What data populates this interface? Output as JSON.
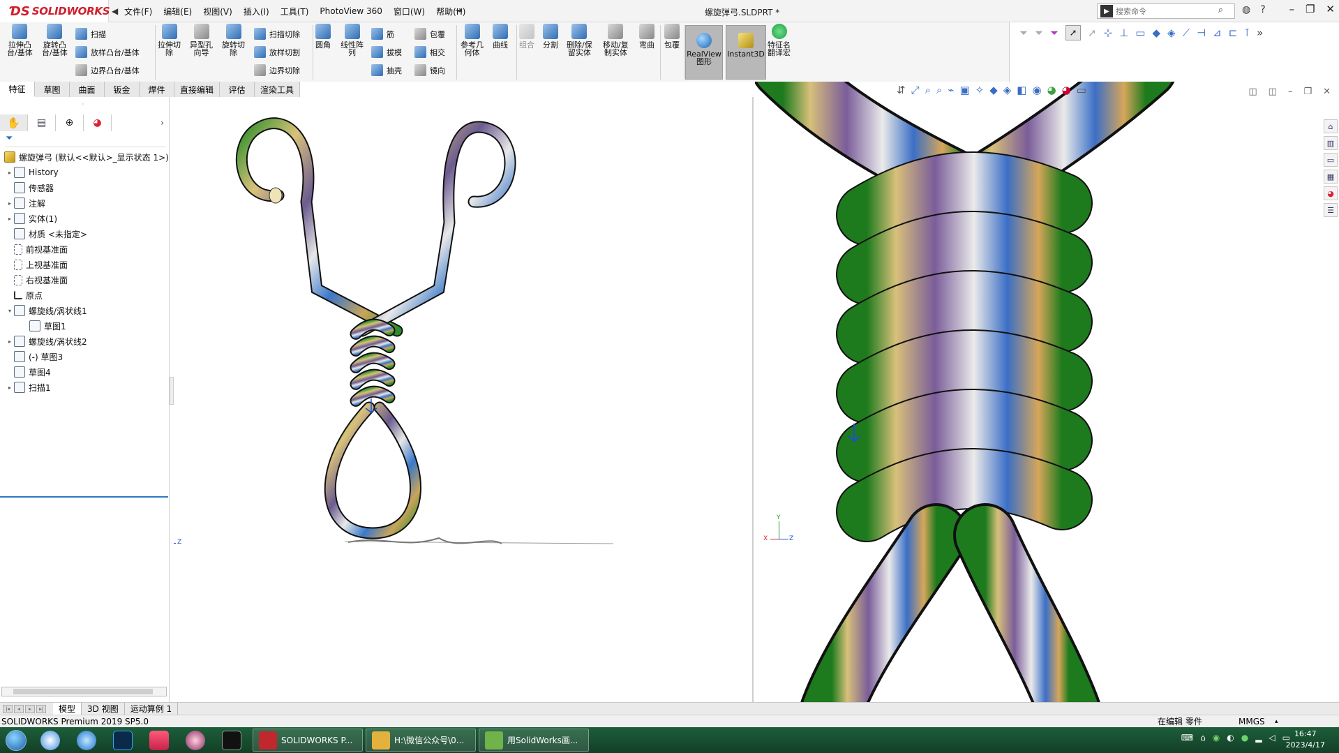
{
  "app": {
    "brand": "SOLIDWORKS",
    "document_title": "螺旋弹弓.SLDPRT *"
  },
  "menu": [
    "文件(F)",
    "编辑(E)",
    "视图(V)",
    "插入(I)",
    "工具(T)",
    "PhotoView 360",
    "窗口(W)",
    "帮助(H)"
  ],
  "search": {
    "placeholder": "搜索命令"
  },
  "commands": {
    "extrude_boss": "拉伸凸\n台/基体",
    "revolve_boss": "旋转凸\n台/基体",
    "sweep": "扫描",
    "loft": "放样凸台/基体",
    "boundary_boss": "边界凸台/基体",
    "extrude_cut": "拉伸切\n除",
    "hole_wizard": "异型孔\n向导",
    "revolve_cut": "旋转切\n除",
    "sweep_cut": "扫描切除",
    "loft_cut": "放样切割",
    "boundary_cut": "边界切除",
    "fillet": "圆角",
    "linear_pattern": "线性阵\n列",
    "rib": "筋",
    "draft": "拔模",
    "shell": "抽壳",
    "wrap": "包覆",
    "intersect": "相交",
    "mirror": "镜向",
    "ref_geometry": "参考几\n何体",
    "curves": "曲线",
    "combine": "组合",
    "split": "分割",
    "delete_keep": "删除/保\n留实体",
    "move_copy": "移动/复\n制实体",
    "flex": "弯曲",
    "wrap2": "包覆",
    "realview": "RealView\n图形",
    "instant3d": "Instant3D",
    "translate": "特征名\n翻译宏"
  },
  "cmd_tabs": [
    "特征",
    "草图",
    "曲面",
    "钣金",
    "焊件",
    "直接编辑",
    "评估",
    "渲染工具"
  ],
  "tree": {
    "root": "螺旋弹弓  (默认<<默认>_显示状态 1>)",
    "nodes": [
      {
        "label": "History",
        "exp": "▸",
        "indent": 0
      },
      {
        "label": "传感器",
        "exp": "",
        "indent": 0
      },
      {
        "label": "注解",
        "exp": "▸",
        "indent": 0
      },
      {
        "label": "实体(1)",
        "exp": "▸",
        "indent": 0
      },
      {
        "label": "材质 <未指定>",
        "exp": "",
        "indent": 0
      },
      {
        "label": "前视基准面",
        "exp": "",
        "indent": 0
      },
      {
        "label": "上视基准面",
        "exp": "",
        "indent": 0
      },
      {
        "label": "右视基准面",
        "exp": "",
        "indent": 0
      },
      {
        "label": "原点",
        "exp": "",
        "indent": 0
      },
      {
        "label": "螺旋线/涡状线1",
        "exp": "▾",
        "indent": 0
      },
      {
        "label": "草图1",
        "exp": "",
        "indent": 1
      },
      {
        "label": "螺旋线/涡状线2",
        "exp": "▸",
        "indent": 0
      },
      {
        "label": "(-) 草图3",
        "exp": "",
        "indent": 0
      },
      {
        "label": "草图4",
        "exp": "",
        "indent": 0
      },
      {
        "label": "扫描1",
        "exp": "▸",
        "indent": 0
      }
    ]
  },
  "bottom_tabs": [
    "模型",
    "3D 视图",
    "运动算例 1"
  ],
  "status": {
    "product": "SOLIDWORKS Premium 2019 SP5.0",
    "editing": "在编辑 零件",
    "units": "MMGS"
  },
  "taskbar": {
    "apps": [
      {
        "label": "SOLIDWORKS P...",
        "color": "#c0282d"
      },
      {
        "label": "H:\\微信公众号\\0...",
        "color": "#e3b23c"
      },
      {
        "label": "用SolidWorks画...",
        "color": "#6fb34a"
      }
    ],
    "time": "16:47",
    "date": "2023/4/17"
  },
  "colors": {
    "accent": "#2c78c6",
    "brand_red": "#d0202e",
    "taskbar": "#1d5e3a"
  }
}
